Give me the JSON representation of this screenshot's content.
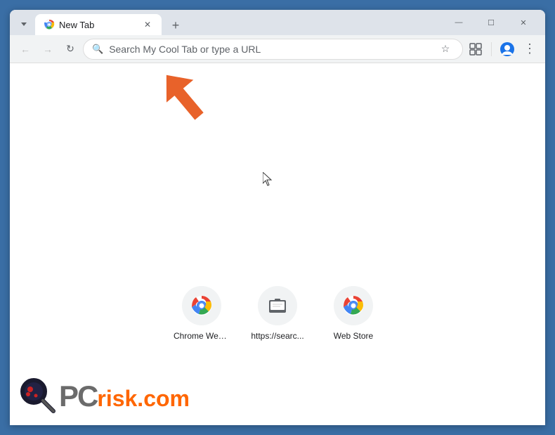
{
  "window": {
    "title": "New Tab",
    "minimize_label": "—",
    "maximize_label": "☐",
    "close_label": "✕",
    "new_tab_label": "+"
  },
  "toolbar": {
    "back_label": "←",
    "forward_label": "→",
    "reload_label": "↻",
    "omnibox_placeholder": "Search My Cool Tab or type a URL",
    "bookmark_label": "☆",
    "extensions_label": "⬡",
    "profile_label": "👤",
    "menu_label": "⋮"
  },
  "shortcuts": [
    {
      "label": "Chrome Web...",
      "type": "chrome"
    },
    {
      "label": "https://searc...",
      "type": "search"
    },
    {
      "label": "Web Store",
      "type": "webstore"
    }
  ],
  "pcrisk": {
    "text_pc": "PC",
    "text_risk": "risk",
    "text_dot": ".",
    "text_com": "com"
  }
}
